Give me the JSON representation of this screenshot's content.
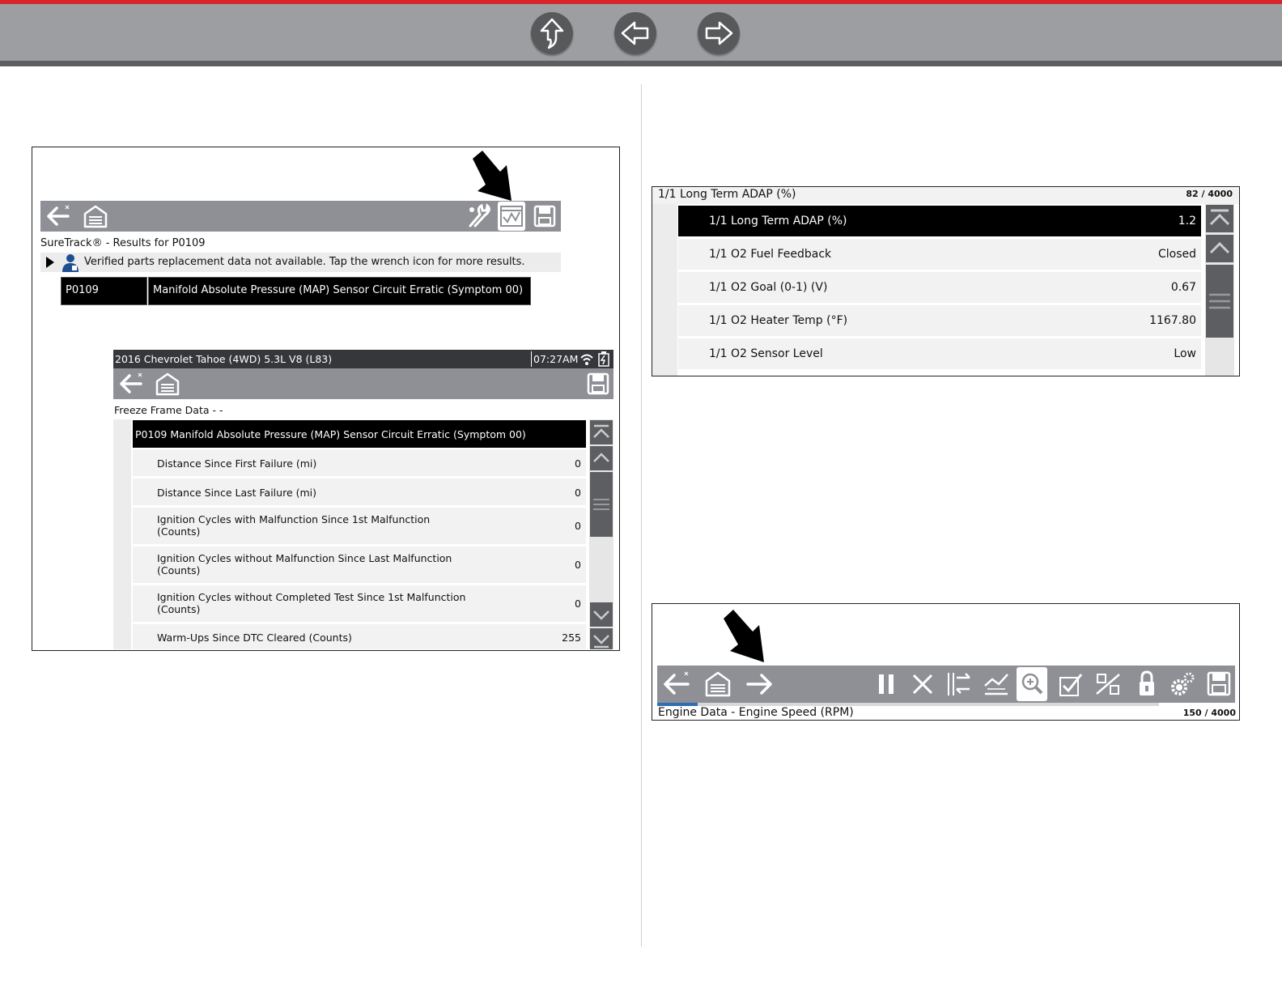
{
  "left_panel": {
    "suretrack": {
      "title": "SureTrack® - Results for P0109",
      "message": "Verified parts replacement data not available. Tap the wrench icon for more results.",
      "code": "P0109",
      "description": "Manifold Absolute Pressure (MAP) Sensor Circuit Erratic (Symptom 00)"
    },
    "freeze_frame": {
      "vehicle": "2016 Chevrolet Tahoe (4WD) 5.3L V8 (L83)",
      "time": "07:27AM",
      "title": "Freeze Frame Data - -",
      "header": "P0109 Manifold Absolute Pressure (MAP) Sensor Circuit Erratic (Symptom 00)",
      "rows": [
        {
          "label": "Distance Since First Failure (mi)",
          "label2": "",
          "value": "0"
        },
        {
          "label": "Distance Since Last Failure (mi)",
          "label2": "",
          "value": "0"
        },
        {
          "label": "Ignition Cycles with Malfunction Since 1st Malfunction",
          "label2": "(Counts)",
          "value": "0"
        },
        {
          "label": "Ignition Cycles without Malfunction Since Last Malfunction",
          "label2": "(Counts)",
          "value": "0"
        },
        {
          "label": "Ignition Cycles without Completed Test Since 1st Malfunction",
          "label2": "(Counts)",
          "value": "0"
        },
        {
          "label": "Warm-Ups Since DTC Cleared (Counts)",
          "label2": "",
          "value": "255"
        }
      ]
    }
  },
  "right_top_panel": {
    "title": "1/1 Long Term ADAP (%)",
    "counter": "82 / 4000",
    "rows": [
      {
        "label": "1/1 Long Term ADAP (%)",
        "value": "1.2",
        "selected": true
      },
      {
        "label": "1/1 O2 Fuel Feedback",
        "value": "Closed"
      },
      {
        "label": "1/1 O2 Goal (0-1) (V)",
        "value": "0.67"
      },
      {
        "label": "1/1 O2 Heater Temp (°F)",
        "value": "1167.80"
      },
      {
        "label": "1/1 O2 Sensor Level",
        "value": "Low"
      }
    ]
  },
  "right_bottom_panel": {
    "title": "Engine Data - Engine Speed (RPM)",
    "counter": "150 / 4000",
    "progress": 0.08
  },
  "colors": {
    "accent_red": "#d6262c",
    "toolbar_gray": "#8e9095",
    "nav_gray": "#9d9ea1",
    "button_dark": "#58595b"
  }
}
